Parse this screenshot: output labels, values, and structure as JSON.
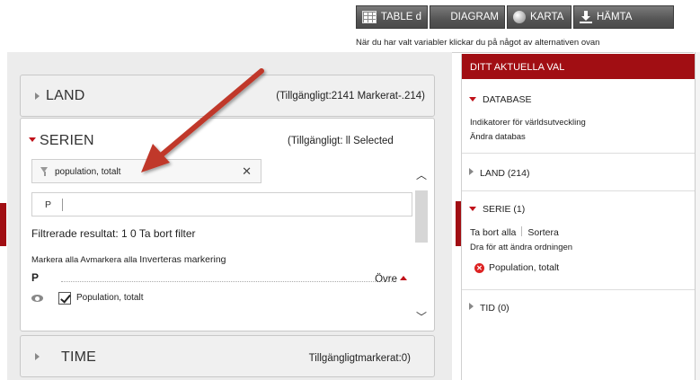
{
  "toolbar": {
    "table_label": "TABLE d",
    "diagram_label": "DIAGRAM",
    "karta_label": "KARTA",
    "hamta_label": "HÄMTA",
    "hint": "När du har valt variabler klickar du på något av alternativen ovan"
  },
  "panels": {
    "land": {
      "title": "LAND",
      "info": "(Tillgängligt:2141 Markerat-.214)"
    },
    "serien": {
      "title": "SERIEN",
      "info": "(Tillgängligt: ll Selected",
      "search_value": "population, totalt",
      "clear_icon": "close-icon",
      "filter_value": "P",
      "filtered_text": "Filtrerade resultat: 1 0 Ta bort filter",
      "select_all": "Markera alla",
      "deselect_all": "Avmarkera alla",
      "invert": "Inverteras markering",
      "group_letter": "P",
      "sort_label": "Övre",
      "item_label": "Population, totalt",
      "item_checked": true
    },
    "time": {
      "title": "TIME",
      "info": "Tillgängligtmarkerat:0)"
    }
  },
  "right_pane": {
    "header": "DITT AKTUELLA VAL",
    "database": {
      "title": "DATABASE",
      "line1": "Indikatorer för världsutveckling",
      "line2": "Ändra databas"
    },
    "land": "LAND (214)",
    "serie": {
      "title": "SERIE (1)",
      "clear_all": "Ta bort alla",
      "sort": "Sortera",
      "drag_hint": "Dra för att ändra ordningen",
      "selected_item": "Population, totalt"
    },
    "tid": "TID (0)"
  },
  "colors": {
    "accent": "#a10e13",
    "arrow": "#c0392b",
    "toolbar_bg": "#555555"
  }
}
